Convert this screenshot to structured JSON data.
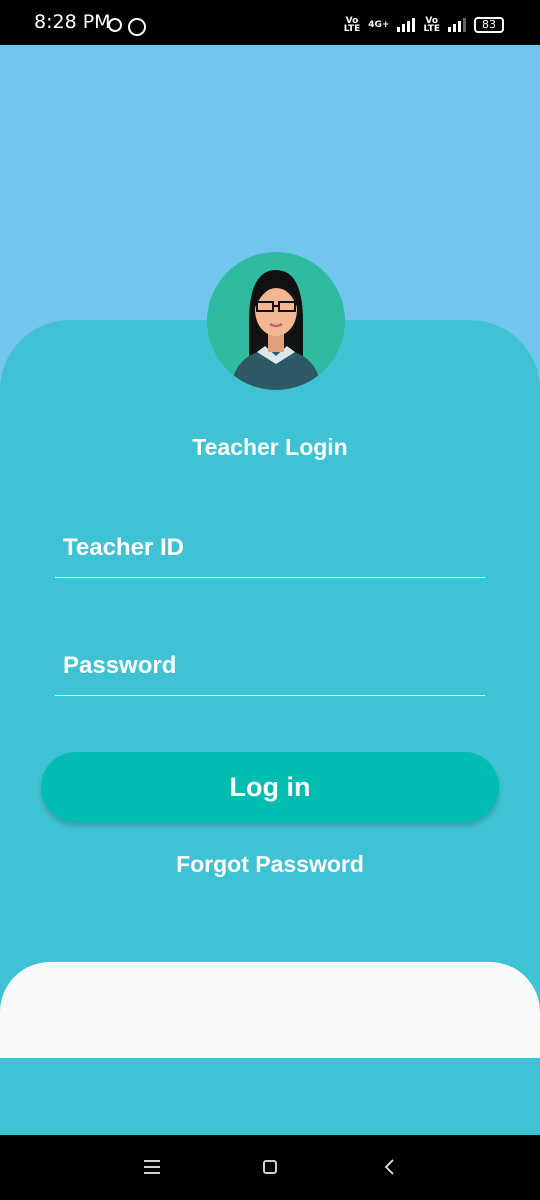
{
  "status_bar": {
    "time": "8:28 PM",
    "sim1_label_top": "Vo",
    "sim1_label_bottom": "LTE",
    "network_label": "4G+",
    "sim2_label_top": "Vo",
    "sim2_label_bottom": "LTE",
    "battery": "83",
    "icons": [
      "alarm-icon",
      "whatsapp-icon",
      "signal-icon",
      "battery-icon"
    ]
  },
  "login": {
    "title": "Teacher Login",
    "teacher_id_placeholder": "Teacher ID",
    "teacher_id_value": "",
    "password_placeholder": "Password",
    "password_value": "",
    "login_label": "Log in",
    "forgot_label": "Forgot Password"
  },
  "nav_bar": {
    "icons": [
      "menu-icon",
      "home-icon",
      "back-icon"
    ]
  },
  "colors": {
    "background_top": "#72C5EC",
    "card": "#3FC3D4",
    "button": "#00BDB1",
    "avatar_bg": "#2EBBA0",
    "sheet": "#F8F9FA"
  }
}
